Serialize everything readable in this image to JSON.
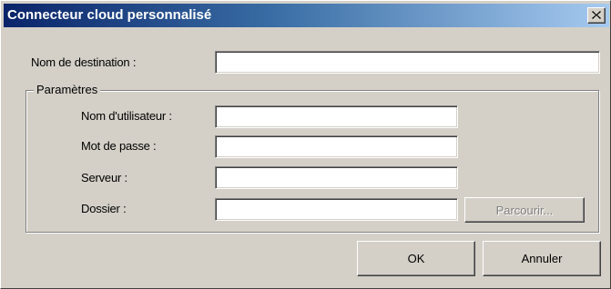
{
  "window": {
    "title": "Connecteur cloud personnalisé"
  },
  "form": {
    "destination_label": "Nom de destination :",
    "destination_value": "",
    "group_title": "Paramètres",
    "username_label": "Nom d'utilisateur :",
    "username_value": "",
    "password_label": "Mot de passe :",
    "password_value": "",
    "server_label": "Serveur :",
    "server_value": "",
    "folder_label": "Dossier :",
    "folder_value": "",
    "browse_label": "Parcourir..."
  },
  "buttons": {
    "ok_label": "OK",
    "cancel_label": "Annuler"
  },
  "colors": {
    "title_bar_start": "#0a246a",
    "title_bar_end": "#a6caf0",
    "dialog_face": "#d4d0c8"
  }
}
